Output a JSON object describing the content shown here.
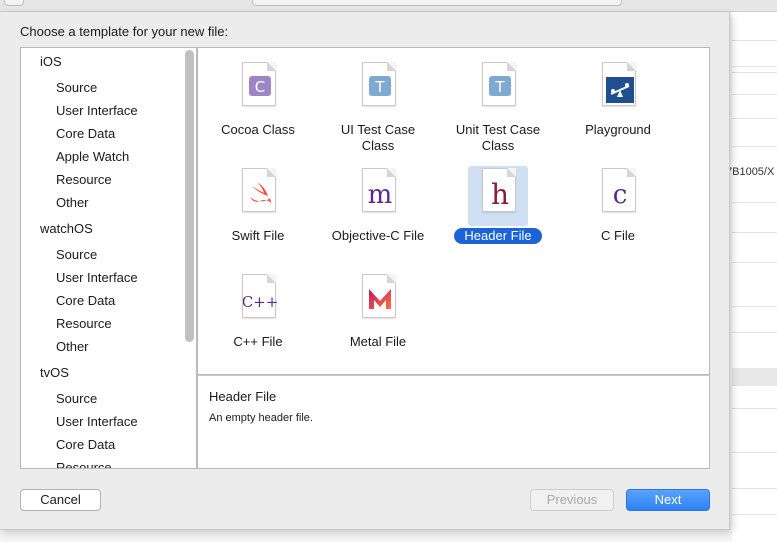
{
  "background": {
    "path_fragment": "7B1005/X"
  },
  "dialog": {
    "prompt": "Choose a template for your new file:"
  },
  "sidebar": {
    "items": [
      {
        "label": "iOS",
        "kind": "platform"
      },
      {
        "label": "Source",
        "kind": "category"
      },
      {
        "label": "User Interface",
        "kind": "category"
      },
      {
        "label": "Core Data",
        "kind": "category"
      },
      {
        "label": "Apple Watch",
        "kind": "category"
      },
      {
        "label": "Resource",
        "kind": "category"
      },
      {
        "label": "Other",
        "kind": "category"
      },
      {
        "label": "watchOS",
        "kind": "platform"
      },
      {
        "label": "Source",
        "kind": "category"
      },
      {
        "label": "User Interface",
        "kind": "category"
      },
      {
        "label": "Core Data",
        "kind": "category"
      },
      {
        "label": "Resource",
        "kind": "category"
      },
      {
        "label": "Other",
        "kind": "category"
      },
      {
        "label": "tvOS",
        "kind": "platform"
      },
      {
        "label": "Source",
        "kind": "category"
      },
      {
        "label": "User Interface",
        "kind": "category"
      },
      {
        "label": "Core Data",
        "kind": "category"
      },
      {
        "label": "Resource",
        "kind": "category"
      }
    ]
  },
  "templates": [
    {
      "label_line1": "Cocoa Class",
      "label_line2": "",
      "icon": "cocoa-class-icon",
      "glyph": "C",
      "selected": false
    },
    {
      "label_line1": "UI Test Case",
      "label_line2": "Class",
      "icon": "ui-test-case-icon",
      "glyph": "T",
      "selected": false
    },
    {
      "label_line1": "Unit Test Case",
      "label_line2": "Class",
      "icon": "unit-test-case-icon",
      "glyph": "T",
      "selected": false
    },
    {
      "label_line1": "Playground",
      "label_line2": "",
      "icon": "playground-icon",
      "glyph": "",
      "selected": false
    },
    {
      "label_line1": "Swift File",
      "label_line2": "",
      "icon": "swift-file-icon",
      "glyph": "",
      "selected": false
    },
    {
      "label_line1": "Objective-C File",
      "label_line2": "",
      "icon": "objective-c-file-icon",
      "glyph": "m",
      "selected": false
    },
    {
      "label_line1": "Header File",
      "label_line2": "",
      "icon": "header-file-icon",
      "glyph": "h",
      "selected": true
    },
    {
      "label_line1": "C File",
      "label_line2": "",
      "icon": "c-file-icon",
      "glyph": "c",
      "selected": false
    },
    {
      "label_line1": "C++ File",
      "label_line2": "",
      "icon": "cpp-file-icon",
      "glyph": "C++",
      "selected": false
    },
    {
      "label_line1": "Metal File",
      "label_line2": "",
      "icon": "metal-file-icon",
      "glyph": "",
      "selected": false
    }
  ],
  "description": {
    "title": "Header File",
    "text": "An empty header file."
  },
  "buttons": {
    "cancel": "Cancel",
    "previous": "Previous",
    "next": "Next"
  },
  "colors": {
    "selection": "#1d63d8",
    "selection_tile": "#cfe0f3",
    "next_button": "#2d82f5",
    "glyph_purple": "#5b2a86",
    "glyph_maroon": "#8b1c33",
    "swift_orange": "#f05138",
    "playground_blue": "#1e4f8f"
  }
}
